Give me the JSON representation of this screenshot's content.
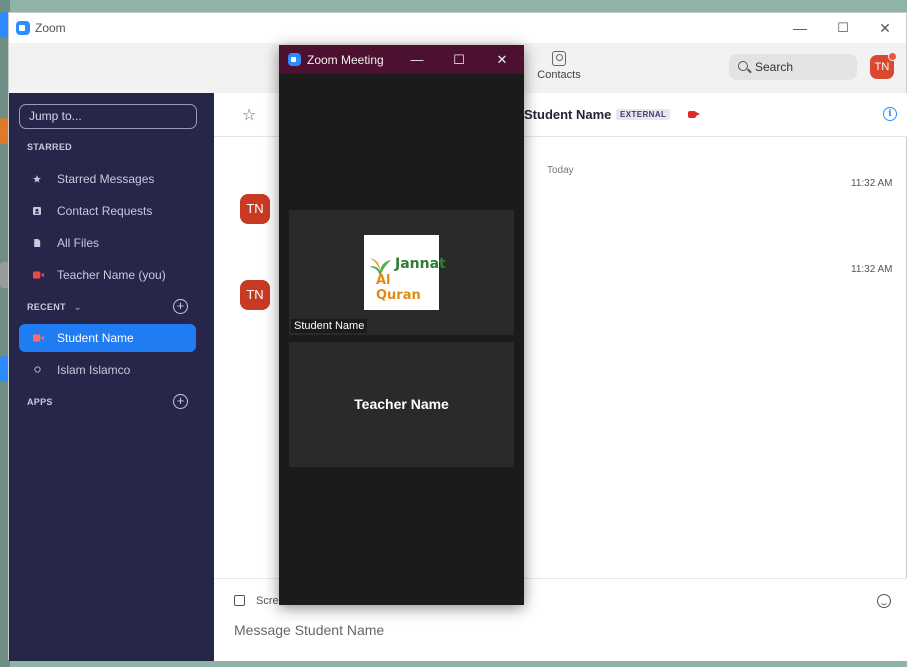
{
  "app": {
    "title": "Zoom"
  },
  "window_controls": {
    "minimize": "—",
    "maximize": "☐",
    "close": "✕"
  },
  "toolbar": {
    "contacts_label": "Contacts",
    "search_label": "Search",
    "avatar_initials": "TN"
  },
  "sidebar": {
    "jump_placeholder": "Jump to...",
    "starred_label": "STARRED",
    "starred_items": [
      {
        "label": "Starred Messages",
        "icon": "star-icon"
      },
      {
        "label": "Contact Requests",
        "icon": "contact-card-icon"
      },
      {
        "label": "All Files",
        "icon": "file-icon"
      },
      {
        "label": "Teacher Name (you)",
        "icon": "video-status-icon"
      }
    ],
    "recent_label": "RECENT",
    "recent_chevron": "⌄",
    "recent_items": [
      {
        "label": "Student Name",
        "icon": "video-status-icon",
        "active": true
      },
      {
        "label": "Islam Islamco",
        "icon": "offline-status-icon",
        "active": false
      }
    ],
    "apps_label": "APPS",
    "add_symbol": "+"
  },
  "chat": {
    "title": "Student Name",
    "badge": "EXTERNAL",
    "date_separator": "Today",
    "messages": [
      {
        "avatar": "TN",
        "time": "11:32 AM"
      },
      {
        "avatar": "TN",
        "time": "11:32 AM"
      }
    ],
    "composer": {
      "screenshot_label": "Scree",
      "placeholder": "Message Student Name"
    }
  },
  "meeting": {
    "title": "Zoom Meeting",
    "controls": {
      "minimize": "—",
      "maximize": "☐",
      "close": "✕"
    },
    "tiles": [
      {
        "name": "Student Name",
        "logo_line1": "Jannat",
        "logo_line2": "Al Quran"
      },
      {
        "name": "Teacher Name"
      }
    ]
  },
  "colors": {
    "sidebar_bg": "#25264a",
    "accent": "#1f7cf3",
    "meeting_titlebar": "#4c1130",
    "avatar": "#c93a24",
    "recording": "#e02828"
  }
}
